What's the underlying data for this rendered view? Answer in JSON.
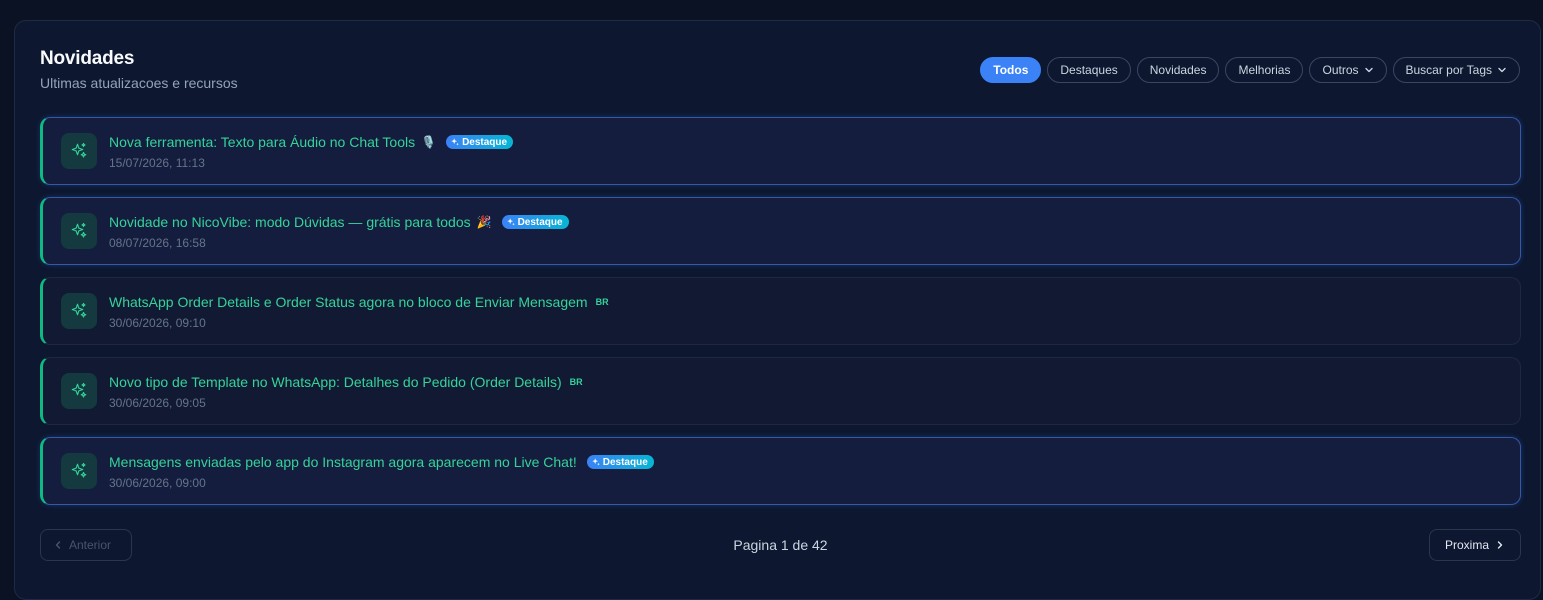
{
  "header": {
    "title": "Novidades",
    "subtitle": "Ultimas atualizacoes e recursos"
  },
  "filters": [
    {
      "label": "Todos",
      "active": true
    },
    {
      "label": "Destaques"
    },
    {
      "label": "Novidades"
    },
    {
      "label": "Melhorias"
    },
    {
      "label": "Outros",
      "dropdown": true
    },
    {
      "label": "Buscar por Tags",
      "dropdown": true
    }
  ],
  "items": [
    {
      "title": "Nova ferramenta: Texto para Áudio no Chat Tools",
      "emoji": "🎙️",
      "badge": "Destaque",
      "lang": "",
      "date": "15/07/2026, 11:13"
    },
    {
      "title": "Novidade no NicoVibe: modo Dúvidas — grátis para todos",
      "emoji": "🎉",
      "badge": "Destaque",
      "lang": "",
      "date": "08/07/2026, 16:58"
    },
    {
      "title": "WhatsApp Order Details e Order Status agora no bloco de Enviar Mensagem",
      "emoji": "",
      "badge": "",
      "lang": "BR",
      "date": "30/06/2026, 09:10"
    },
    {
      "title": "Novo tipo de Template no WhatsApp: Detalhes do Pedido (Order Details)",
      "emoji": "",
      "badge": "",
      "lang": "BR",
      "date": "30/06/2026, 09:05"
    },
    {
      "title": "Mensagens enviadas pelo app do Instagram agora aparecem no Live Chat!",
      "emoji": "",
      "badge": "Destaque",
      "lang": "",
      "date": "30/06/2026, 09:00"
    }
  ],
  "pagination": {
    "prev_label": "Anterior",
    "next_label": "Proxima",
    "page_text": "Pagina 1 de 42"
  },
  "colors": {
    "accent": "#3b82f6",
    "title_green": "#34d399",
    "panel": "#0d1730"
  },
  "icons": [
    "sparkles-icon",
    "chevron-down-icon",
    "chevron-left-icon",
    "chevron-right-icon"
  ]
}
